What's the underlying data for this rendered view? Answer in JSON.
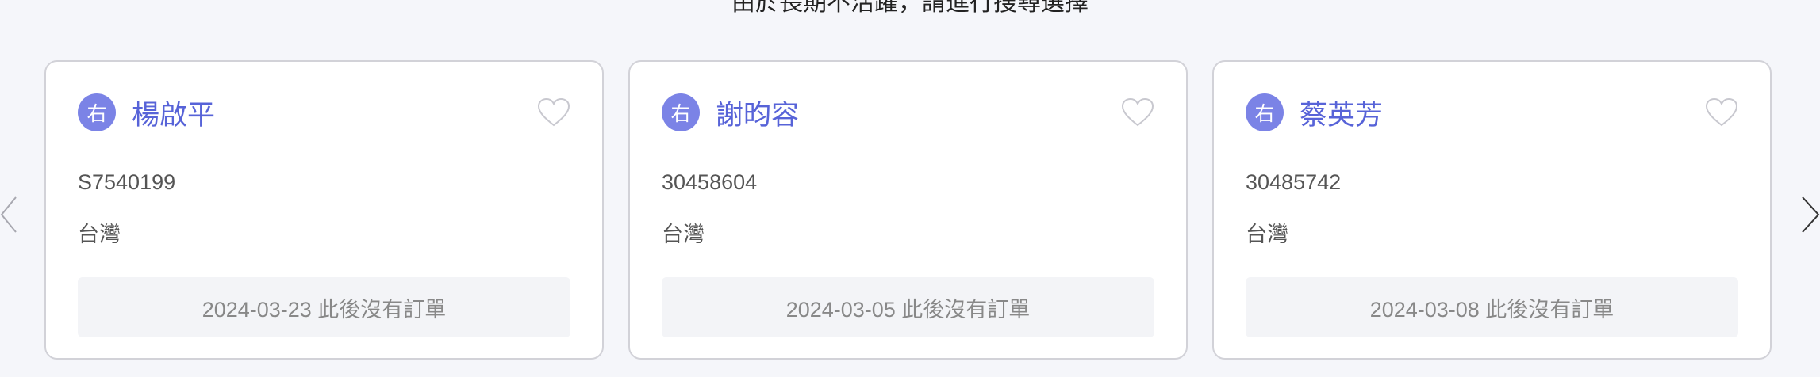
{
  "header": {
    "top_text": "由於長期不活躍，請進行搜尋選擇"
  },
  "nav": {
    "prev_icon": "chevron-left-icon",
    "next_icon": "chevron-right-icon"
  },
  "cards": [
    {
      "avatar_label": "右",
      "name": "楊啟平",
      "id": "S7540199",
      "country": "台灣",
      "status": "2024-03-23 此後沒有訂單",
      "favorite_icon": "heart-outline-icon"
    },
    {
      "avatar_label": "右",
      "name": "謝昀容",
      "id": "30458604",
      "country": "台灣",
      "status": "2024-03-05 此後沒有訂單",
      "favorite_icon": "heart-outline-icon"
    },
    {
      "avatar_label": "右",
      "name": "蔡英芳",
      "id": "30485742",
      "country": "台灣",
      "status": "2024-03-08 此後沒有訂單",
      "favorite_icon": "heart-outline-icon"
    }
  ],
  "colors": {
    "accent": "#5763d8",
    "avatar_bg": "#7b83e6",
    "page_bg": "#f5f6fa"
  }
}
